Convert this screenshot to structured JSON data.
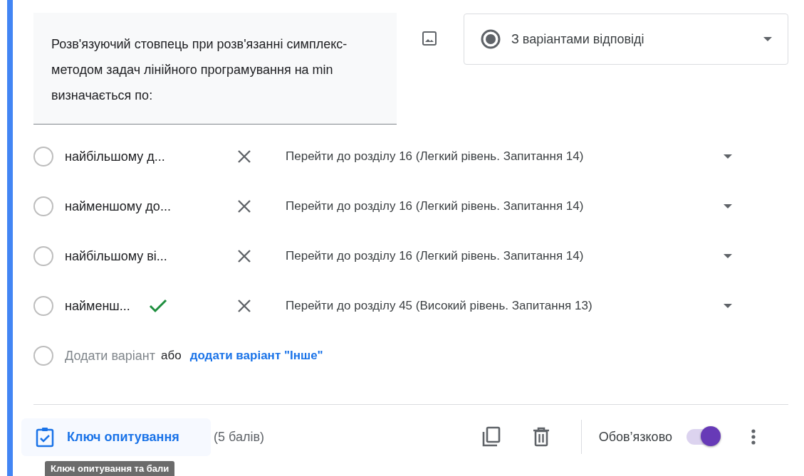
{
  "question": {
    "text": "Розв'язуючий стовпець при розв'язанні симплекс-методом задач лінійного програмування на min визначається по:",
    "type_select": "З варіантами відповіді"
  },
  "options": [
    {
      "text": "найбільшому д...",
      "correct": false,
      "route": "Перейти до розділу 16 (Легкий рівень. Запитання 14)"
    },
    {
      "text": "найменшому до...",
      "correct": false,
      "route": "Перейти до розділу 16 (Легкий рівень. Запитання 14)"
    },
    {
      "text": "найбільшому ві...",
      "correct": false,
      "route": "Перейти до розділу 16 (Легкий рівень. Запитання 14)"
    },
    {
      "text": "найменш...",
      "correct": true,
      "route": "Перейти до розділу 45 (Високий рівень. Запитання 13)"
    }
  ],
  "add_option": {
    "placeholder": "Додати варіант",
    "or": "або",
    "other_link": "додати варіант \"Інше\""
  },
  "footer": {
    "answer_key": "Ключ опитування",
    "points": "(5 балів)",
    "required_label": "Обов’язково",
    "required_on": true,
    "tooltip": "Ключ опитування та бали"
  }
}
